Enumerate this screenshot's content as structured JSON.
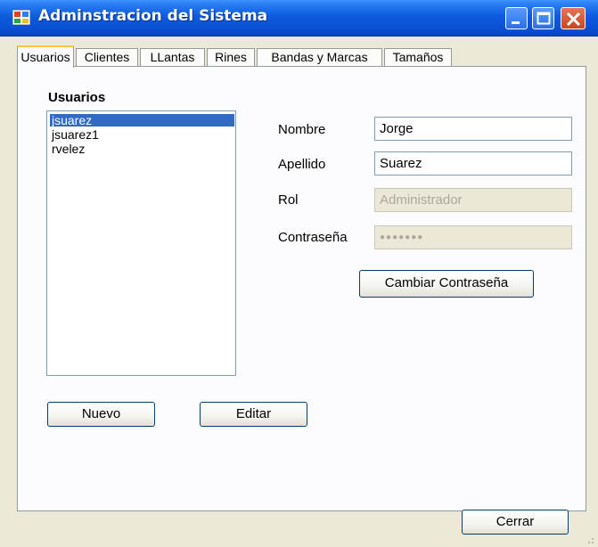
{
  "window": {
    "title": "Adminstracion del Sistema"
  },
  "tabs": [
    {
      "label": "Usuarios",
      "active": true
    },
    {
      "label": "Clientes",
      "active": false
    },
    {
      "label": "LLantas",
      "active": false
    },
    {
      "label": "Rines",
      "active": false
    },
    {
      "label": "Bandas y Marcas",
      "active": false
    },
    {
      "label": "Tamaños",
      "active": false
    }
  ],
  "users": {
    "heading": "Usuarios",
    "items": [
      "jsuarez",
      "jsuarez1",
      "rvelez"
    ],
    "selected": "jsuarez"
  },
  "form": {
    "nombre_label": "Nombre",
    "nombre_value": "Jorge",
    "apellido_label": "Apellido",
    "apellido_value": "Suarez",
    "rol_label": "Rol",
    "rol_value": "Administrador",
    "password_label": "Contraseña",
    "password_value": "●●●●●●●"
  },
  "buttons": {
    "change_password": "Cambiar Contraseña",
    "new": "Nuevo",
    "edit": "Editar",
    "close": "Cerrar"
  },
  "colors": {
    "titlebar": "#0a50d2",
    "selection": "#316ac5",
    "tab_active_accent": "#ffc73c"
  },
  "icons": {
    "app": "window-app-icon",
    "minimize": "minimize-icon",
    "maximize": "maximize-icon",
    "close": "close-icon"
  }
}
